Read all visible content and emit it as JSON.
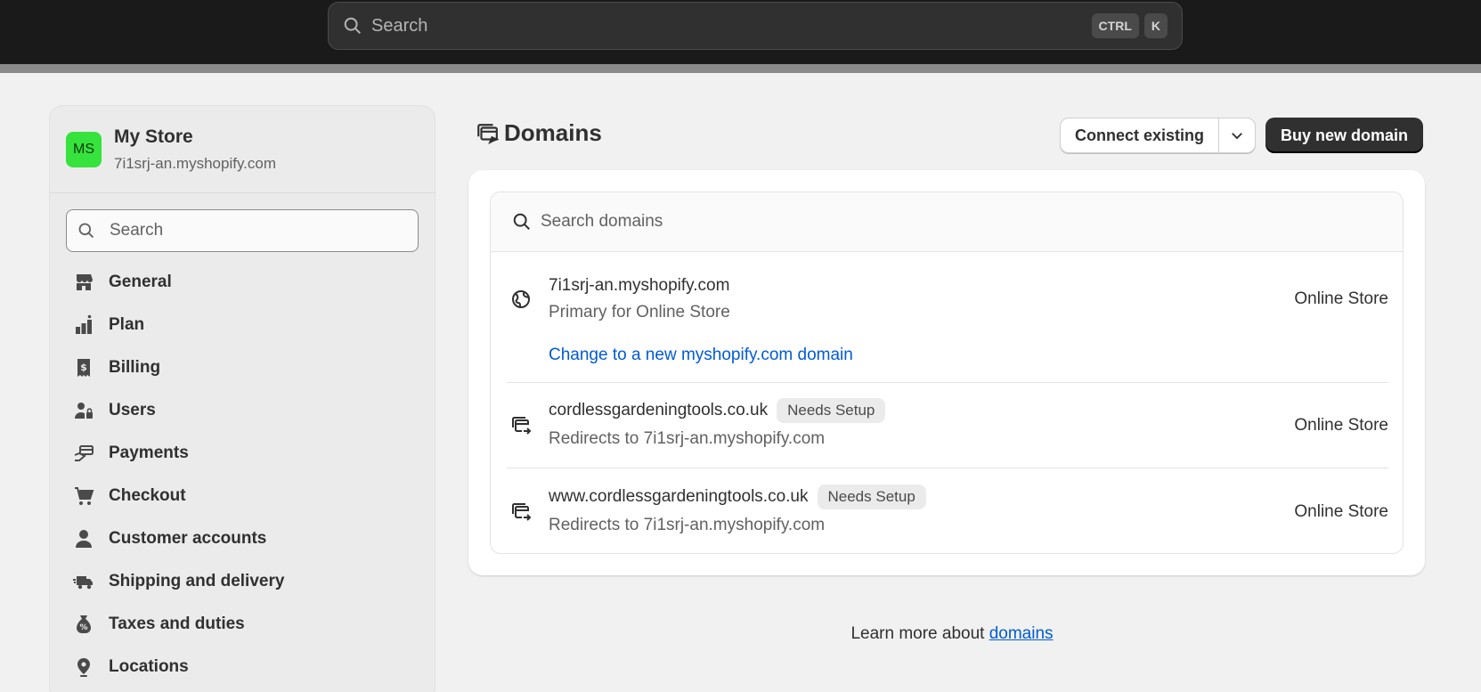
{
  "topbar": {
    "search_placeholder": "Search",
    "kbd_ctrl": "CTRL",
    "kbd_k": "K"
  },
  "sidebar": {
    "avatar_initials": "MS",
    "store_name": "My Store",
    "store_url": "7i1srj-an.myshopify.com",
    "search_placeholder": "Search",
    "items": [
      {
        "label": "General",
        "icon": "store-icon"
      },
      {
        "label": "Plan",
        "icon": "plan-icon"
      },
      {
        "label": "Billing",
        "icon": "billing-icon"
      },
      {
        "label": "Users",
        "icon": "users-icon"
      },
      {
        "label": "Payments",
        "icon": "payments-icon"
      },
      {
        "label": "Checkout",
        "icon": "cart-icon"
      },
      {
        "label": "Customer accounts",
        "icon": "person-icon"
      },
      {
        "label": "Shipping and delivery",
        "icon": "truck-icon"
      },
      {
        "label": "Taxes and duties",
        "icon": "tax-icon"
      },
      {
        "label": "Locations",
        "icon": "location-icon"
      }
    ]
  },
  "main": {
    "title": "Domains",
    "connect_label": "Connect existing",
    "buy_label": "Buy new domain",
    "search_placeholder": "Search domains",
    "domains": [
      {
        "name": "7i1srj-an.myshopify.com",
        "sub": "Primary for Online Store",
        "channel": "Online Store",
        "link": "Change to a new myshopify.com domain",
        "icon": "globe-icon"
      },
      {
        "name": "cordlessgardeningtools.co.uk",
        "badge": "Needs Setup",
        "sub": "Redirects to 7i1srj-an.myshopify.com",
        "channel": "Online Store",
        "icon": "redirect-icon"
      },
      {
        "name": "www.cordlessgardeningtools.co.uk",
        "badge": "Needs Setup",
        "sub": "Redirects to 7i1srj-an.myshopify.com",
        "channel": "Online Store",
        "icon": "redirect-icon"
      }
    ],
    "learn_prefix": "Learn more about ",
    "learn_link": "domains"
  },
  "colors": {
    "accent_link": "#005bd3",
    "avatar_bg": "#36e23c",
    "topbar_bg": "#1a1a1a",
    "primary_button": "#303030"
  }
}
